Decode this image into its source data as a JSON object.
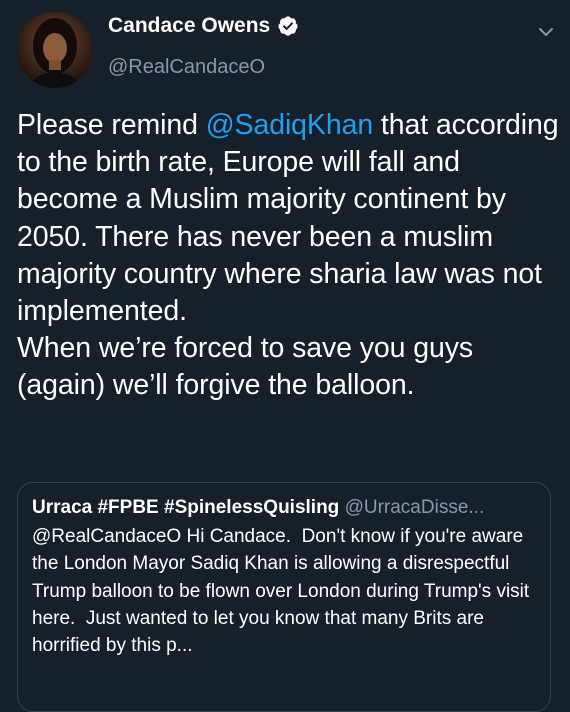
{
  "tweet": {
    "author": {
      "name": "Candace Owens",
      "handle": "@RealCandaceO",
      "verified": true
    },
    "text_before_mention": "Please remind ",
    "mention": "@SadiqKhan",
    "text_after_mention": " that according to the birth rate, Europe will fall and become a Muslim majority continent by 2050. There has never been a muslim majority country where sharia law was not implemented.\nWhen we’re forced to save you guys (again) we’ll forgive the balloon."
  },
  "quoted_tweet": {
    "name": "Urraca #FPBE #SpinelessQuisling",
    "handle": "@UrracaDisse...",
    "text": "@RealCandaceO Hi Candace.  Don't know if you're aware the London Mayor Sadiq Khan is allowing a disrespectful Trump balloon to be flown over London during Trump's visit here.  Just wanted to let you know that many Brits are horrified by this p..."
  },
  "icons": {
    "verified": "verified-badge-icon",
    "menu": "chevron-down-icon"
  },
  "colors": {
    "background": "#15202b",
    "text": "#ffffff",
    "secondary": "#8899a6",
    "link": "#1da1f2",
    "border": "#38444d"
  }
}
